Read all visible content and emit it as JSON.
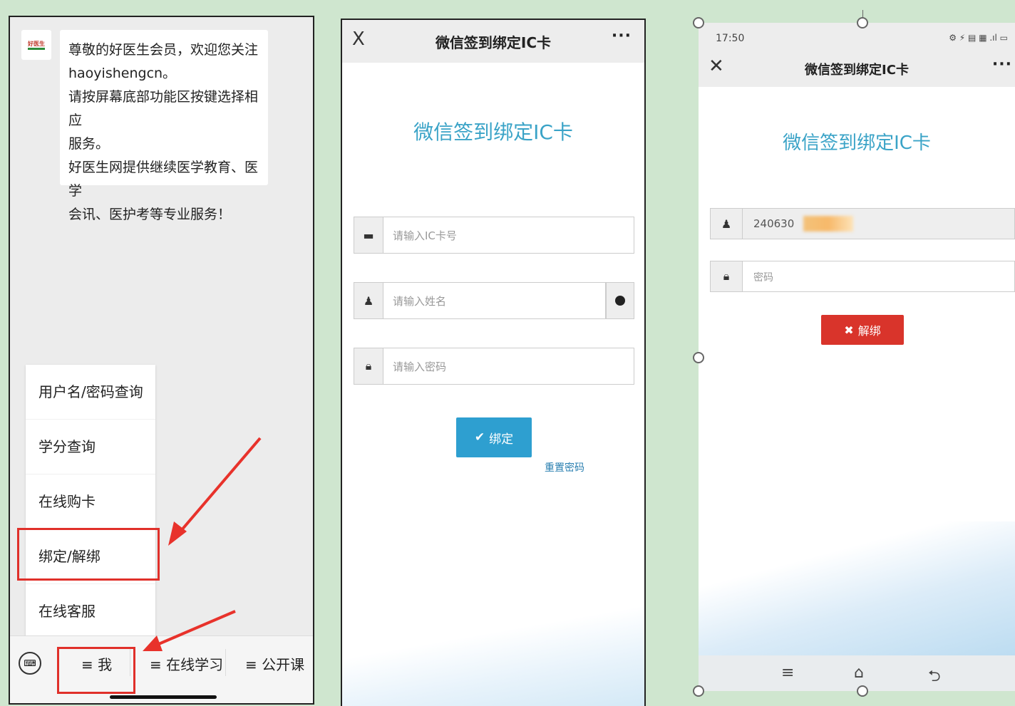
{
  "panel1": {
    "avatar_logo": "好医生",
    "message": "尊敬的好医生会员，欢迎您关注\nhaoyishengcn。\n请按屏幕底部功能区按键选择相应\n服务。\n好医生网提供继续医学教育、医学\n会讯、医护考等专业服务！",
    "menu_items": [
      "用户名/密码查询",
      "学分查询",
      "在线购卡",
      "绑定/解绑",
      "在线客服"
    ],
    "keyboard_icon": "keyboard-icon",
    "tabs": [
      "≡ 我",
      "≡ 在线学习",
      "≡ 公开课"
    ]
  },
  "panel2": {
    "nav": {
      "close": "X",
      "title": "微信签到绑定IC卡",
      "more": "···"
    },
    "heading": "微信签到绑定IC卡",
    "ic_placeholder": "请输入IC卡号",
    "name_placeholder": "请输入姓名",
    "password_placeholder": "请输入密码",
    "bind_button": "绑定",
    "reset_link": "重置密码"
  },
  "panel3": {
    "status_time": "17:50",
    "status_icons": "⚙ ⚡ ▤ ▦ .ıl ▭",
    "nav": {
      "close": "✕",
      "title": "微信签到绑定IC卡",
      "more": "···"
    },
    "heading": "微信签到绑定IC卡",
    "card_value": "240630",
    "password_placeholder": "密码",
    "unbind_button": "解绑",
    "android_nav": [
      "≡",
      "⌂",
      "⮌"
    ]
  },
  "colors": {
    "heading": "#3aa3c7",
    "bind_btn": "#2e9fd0",
    "unbind_btn": "#d9342b",
    "highlight": "#e0302a"
  }
}
